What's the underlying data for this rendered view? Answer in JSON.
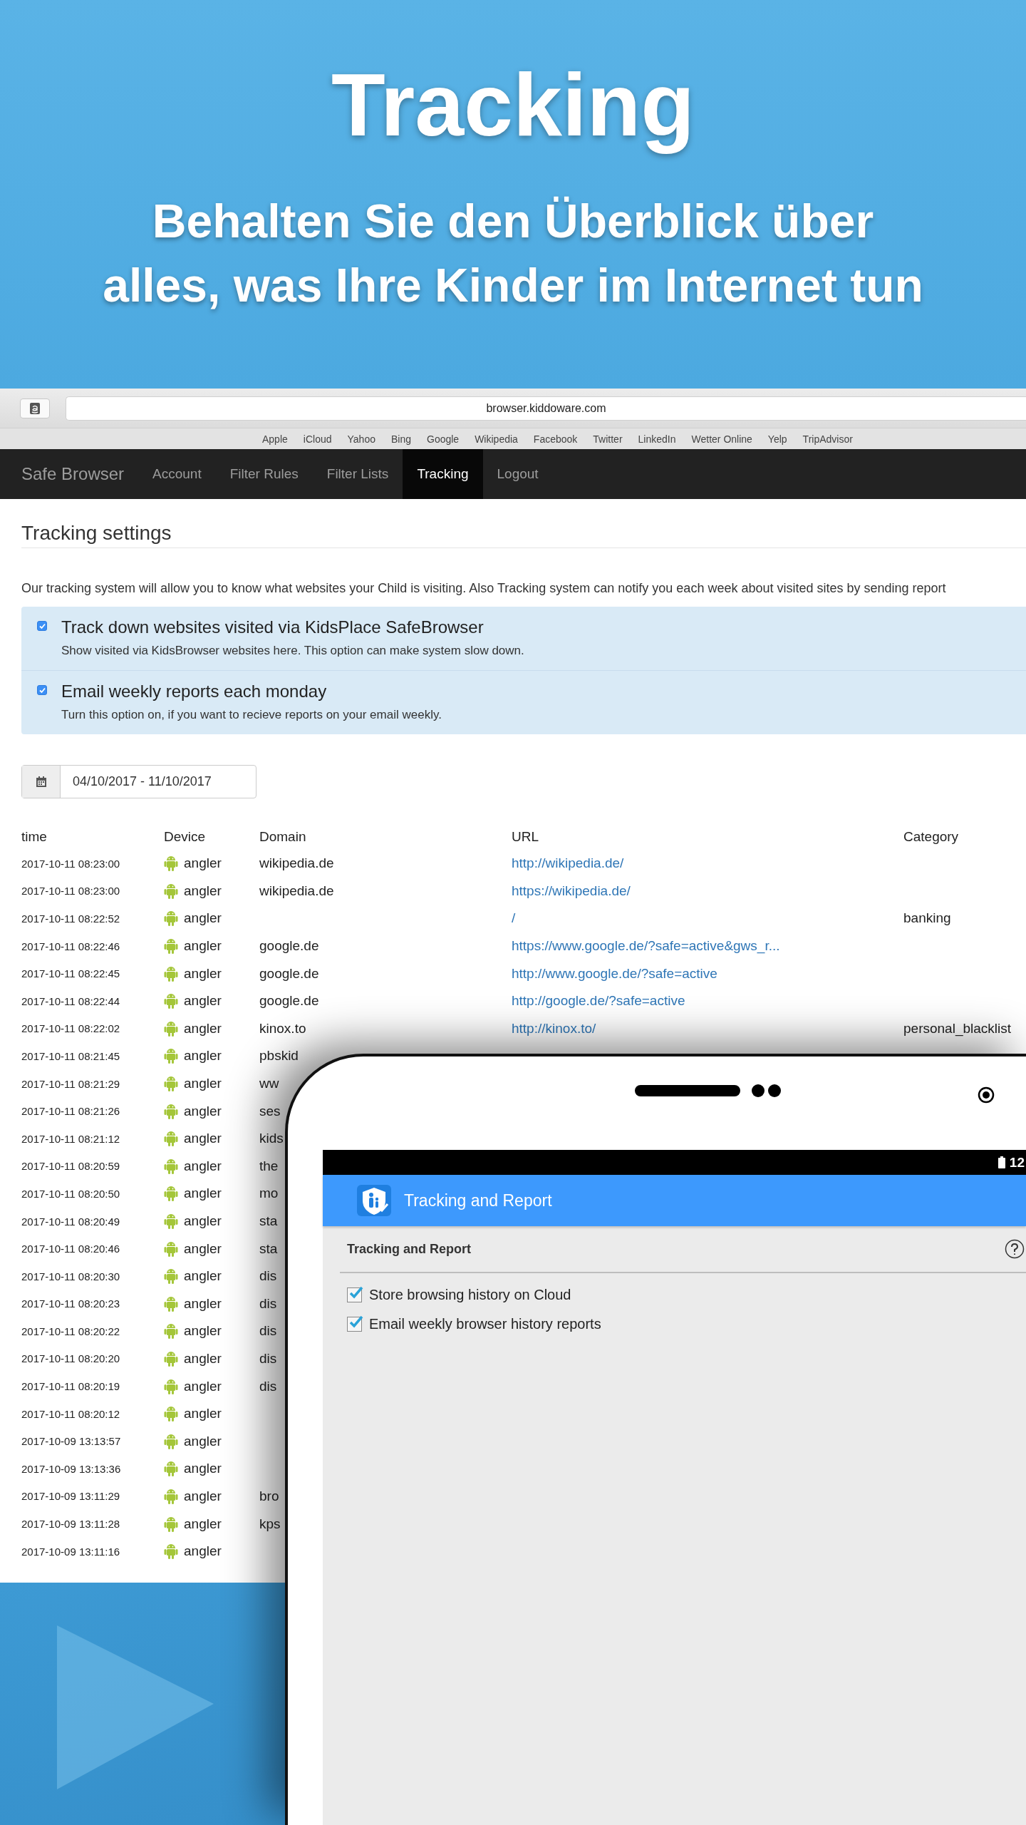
{
  "banner": {
    "title": "Tracking",
    "subtitle_lines": [
      "Behalten Sie den Überblick über",
      "alles, was Ihre Kinder im Internet tun"
    ]
  },
  "browser": {
    "address": "browser.kiddoware.com",
    "bookmarks": [
      "Apple",
      "iCloud",
      "Yahoo",
      "Bing",
      "Google",
      "Wikipedia",
      "Facebook",
      "Twitter",
      "LinkedIn",
      "Wetter Online",
      "Yelp",
      "TripAdvisor"
    ]
  },
  "site": {
    "brand": "Safe Browser",
    "nav": [
      {
        "label": "Account",
        "selected": false
      },
      {
        "label": "Filter Rules",
        "selected": false
      },
      {
        "label": "Filter Lists",
        "selected": false
      },
      {
        "label": "Tracking",
        "selected": true
      },
      {
        "label": "Logout",
        "selected": false
      }
    ]
  },
  "page": {
    "heading": "Tracking settings",
    "intro": "Our tracking system will allow you to know what websites your Child is visiting. Also Tracking system can notify you each week about visited sites by sending report",
    "options": [
      {
        "title": "Track down websites visited via KidsPlace SafeBrowser",
        "description": "Show visited via KidsBrowser websites here. This option can make system slow down.",
        "checked": true
      },
      {
        "title": "Email weekly reports each monday",
        "description": "Turn this option on, if you want to recieve reports on your email weekly.",
        "checked": true
      }
    ],
    "date_range": "04/10/2017 - 11/10/2017"
  },
  "table": {
    "columns": [
      "time",
      "Device",
      "Domain",
      "URL",
      "Category"
    ],
    "rows": [
      {
        "time": "2017-10-11 08:23:00",
        "device": "angler",
        "domain": "wikipedia.de",
        "url": "http://wikipedia.de/",
        "category": ""
      },
      {
        "time": "2017-10-11 08:23:00",
        "device": "angler",
        "domain": "wikipedia.de",
        "url": "https://wikipedia.de/",
        "category": ""
      },
      {
        "time": "2017-10-11 08:22:52",
        "device": "angler",
        "domain": "",
        "url": "/",
        "category": "banking"
      },
      {
        "time": "2017-10-11 08:22:46",
        "device": "angler",
        "domain": "google.de",
        "url": "https://www.google.de/?safe=active&gws_r...",
        "category": ""
      },
      {
        "time": "2017-10-11 08:22:45",
        "device": "angler",
        "domain": "google.de",
        "url": "http://www.google.de/?safe=active",
        "category": ""
      },
      {
        "time": "2017-10-11 08:22:44",
        "device": "angler",
        "domain": "google.de",
        "url": "http://google.de/?safe=active",
        "category": ""
      },
      {
        "time": "2017-10-11 08:22:02",
        "device": "angler",
        "domain": "kinox.to",
        "url": "http://kinox.to/",
        "category": "personal_blacklist"
      },
      {
        "time": "2017-10-11 08:21:45",
        "device": "angler",
        "domain": "pbskid",
        "url": "",
        "category": ""
      },
      {
        "time": "2017-10-11 08:21:29",
        "device": "angler",
        "domain": "ww",
        "url": "",
        "category": ""
      },
      {
        "time": "2017-10-11 08:21:26",
        "device": "angler",
        "domain": "ses",
        "url": "",
        "category": ""
      },
      {
        "time": "2017-10-11 08:21:12",
        "device": "angler",
        "domain": "kids",
        "url": "",
        "category": ""
      },
      {
        "time": "2017-10-11 08:20:59",
        "device": "angler",
        "domain": "the",
        "url": "",
        "category": ""
      },
      {
        "time": "2017-10-11 08:20:50",
        "device": "angler",
        "domain": "mo",
        "url": "",
        "category": ""
      },
      {
        "time": "2017-10-11 08:20:49",
        "device": "angler",
        "domain": "sta",
        "url": "",
        "category": ""
      },
      {
        "time": "2017-10-11 08:20:46",
        "device": "angler",
        "domain": "sta",
        "url": "",
        "category": ""
      },
      {
        "time": "2017-10-11 08:20:30",
        "device": "angler",
        "domain": "dis",
        "url": "",
        "category": ""
      },
      {
        "time": "2017-10-11 08:20:23",
        "device": "angler",
        "domain": "dis",
        "url": "",
        "category": ""
      },
      {
        "time": "2017-10-11 08:20:22",
        "device": "angler",
        "domain": "dis",
        "url": "",
        "category": ""
      },
      {
        "time": "2017-10-11 08:20:20",
        "device": "angler",
        "domain": "dis",
        "url": "",
        "category": ""
      },
      {
        "time": "2017-10-11 08:20:19",
        "device": "angler",
        "domain": "dis",
        "url": "",
        "category": ""
      },
      {
        "time": "2017-10-11 08:20:12",
        "device": "angler",
        "domain": "",
        "url": "",
        "category": ""
      },
      {
        "time": "2017-10-09 13:13:57",
        "device": "angler",
        "domain": "",
        "url": "",
        "category": ""
      },
      {
        "time": "2017-10-09 13:13:36",
        "device": "angler",
        "domain": "",
        "url": "",
        "category": ""
      },
      {
        "time": "2017-10-09 13:11:29",
        "device": "angler",
        "domain": "bro",
        "url": "",
        "category": ""
      },
      {
        "time": "2017-10-09 13:11:28",
        "device": "angler",
        "domain": "kps",
        "url": "",
        "category": ""
      },
      {
        "time": "2017-10-09 13:11:16",
        "device": "angler",
        "domain": "",
        "url": "",
        "category": ""
      }
    ]
  },
  "tablet": {
    "status_time": "12",
    "app_title": "Tracking and Report",
    "section_title": "Tracking and Report",
    "options": [
      {
        "label": "Store browsing history on Cloud",
        "checked": true
      },
      {
        "label": "Email weekly browser history reports",
        "checked": true
      }
    ]
  }
}
